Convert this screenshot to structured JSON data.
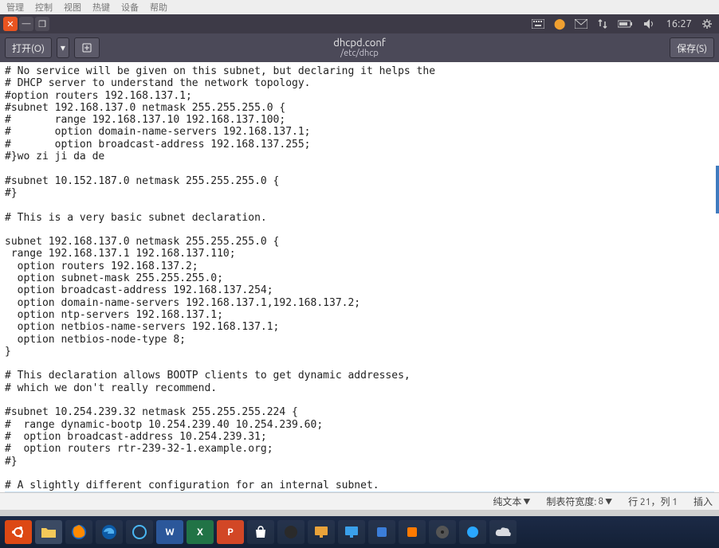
{
  "browser_menu": {
    "items": [
      "管理",
      "控制",
      "视图",
      "热键",
      "设备",
      "帮助"
    ]
  },
  "top_panel": {
    "window_close": "✕",
    "window_min": "—",
    "window_max": "❐",
    "clock": "16:27",
    "indicators": {
      "keyboard": "⌨",
      "network": "↕",
      "battery": "⚡",
      "volume": "🔊",
      "gear": "⚙"
    }
  },
  "headerbar": {
    "open_label": "打开(O)",
    "arrow": "▾",
    "pin_icon": "📌",
    "title": "dhcpd.conf",
    "subtitle": "/etc/dhcp",
    "save_label": "保存(S)"
  },
  "editor": {
    "lines": [
      "# No service will be given on this subnet, but declaring it helps the",
      "# DHCP server to understand the network topology.",
      "#option routers 192.168.137.1;",
      "#subnet 192.168.137.0 netmask 255.255.255.0 {",
      "#       range 192.168.137.10 192.168.137.100;",
      "#       option domain-name-servers 192.168.137.1;",
      "#       option broadcast-address 192.168.137.255;",
      "#}wo zi ji da de",
      "",
      "#subnet 10.152.187.0 netmask 255.255.255.0 {",
      "#}",
      "",
      "# This is a very basic subnet declaration.",
      "",
      "subnet 192.168.137.0 netmask 255.255.255.0 {",
      " range 192.168.137.1 192.168.137.110;",
      "  option routers 192.168.137.2;",
      "  option subnet-mask 255.255.255.0;",
      "  option broadcast-address 192.168.137.254;",
      "  option domain-name-servers 192.168.137.1,192.168.137.2;",
      "  option ntp-servers 192.168.137.1;",
      "  option netbios-name-servers 192.168.137.1;",
      "  option netbios-node-type 8;",
      "}",
      "",
      "# This declaration allows BOOTP clients to get dynamic addresses,",
      "# which we don't really recommend.",
      "",
      "#subnet 10.254.239.32 netmask 255.255.255.224 {",
      "#  range dynamic-bootp 10.254.239.40 10.254.239.60;",
      "#  option broadcast-address 10.254.239.31;",
      "#  option routers rtr-239-32-1.example.org;",
      "#}",
      "",
      "# A slightly different configuration for an internal subnet."
    ],
    "highlighted_last_line": "#subnet 192.168.137.0 netmask 255.255.255.0 {"
  },
  "statusbar": {
    "syntax_label": "纯文本",
    "tab_width_label": "制表符宽度:",
    "tab_width_value": "8",
    "line_col": "行 21，列 1",
    "insert_mode": "插入"
  },
  "taskbar": {
    "icons": [
      "ubuntu-icon",
      "folder-icon",
      "firefox-icon",
      "firefox-blue-icon",
      "cortana-icon",
      "word-icon",
      "excel-icon",
      "powerpoint-icon",
      "vlc-icon",
      "circle-icon",
      "display-icon",
      "monitor-icon",
      "blue-box-icon",
      "orange-box-icon",
      "disc-icon",
      "blue-dot-icon",
      "cloud-icon"
    ]
  }
}
